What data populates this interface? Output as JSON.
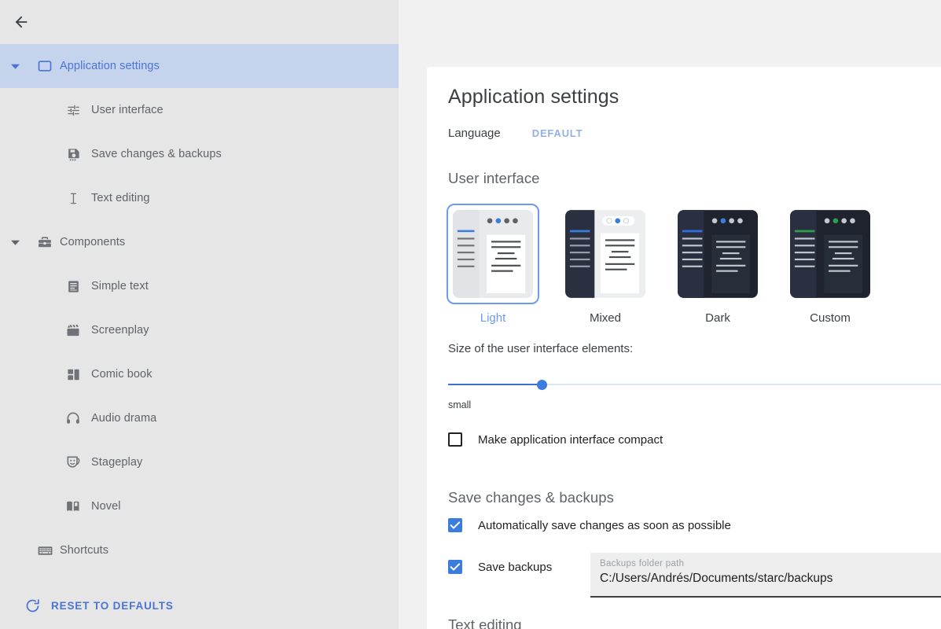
{
  "sidebar": {
    "back_icon": "back-arrow-icon",
    "items": [
      {
        "label": "Application settings",
        "icon": "window-icon",
        "level": 0,
        "selected": true,
        "caret": "down"
      },
      {
        "label": "User interface",
        "icon": "sliders-icon",
        "level": 1,
        "selected": false,
        "caret": ""
      },
      {
        "label": "Save changes & backups",
        "icon": "floppy-disk-icon",
        "level": 1,
        "selected": false,
        "caret": ""
      },
      {
        "label": "Text editing",
        "icon": "text-cursor-icon",
        "level": 1,
        "selected": false,
        "caret": ""
      },
      {
        "label": "Components",
        "icon": "toolbox-icon",
        "level": 0,
        "selected": false,
        "caret": "down"
      },
      {
        "label": "Simple text",
        "icon": "document-lines-icon",
        "level": 1,
        "selected": false,
        "caret": ""
      },
      {
        "label": "Screenplay",
        "icon": "clapperboard-icon",
        "level": 1,
        "selected": false,
        "caret": ""
      },
      {
        "label": "Comic book",
        "icon": "grid-panels-icon",
        "level": 1,
        "selected": false,
        "caret": ""
      },
      {
        "label": "Audio drama",
        "icon": "headphones-icon",
        "level": 1,
        "selected": false,
        "caret": ""
      },
      {
        "label": "Stageplay",
        "icon": "theater-masks-icon",
        "level": 1,
        "selected": false,
        "caret": ""
      },
      {
        "label": "Novel",
        "icon": "open-book-icon",
        "level": 1,
        "selected": false,
        "caret": ""
      },
      {
        "label": "Shortcuts",
        "icon": "keyboard-icon",
        "level": 0,
        "selected": false,
        "caret": ""
      }
    ],
    "reset": {
      "label": "RESET TO DEFAULTS",
      "icon": "refresh-icon"
    }
  },
  "main": {
    "title": "Application settings",
    "language": {
      "label": "Language",
      "value": "DEFAULT"
    },
    "user_interface": {
      "section_title": "User interface",
      "themes": [
        {
          "name": "Light",
          "selected": true,
          "accent": "#3b7ddd"
        },
        {
          "name": "Mixed",
          "selected": false,
          "accent": "#3b7ddd"
        },
        {
          "name": "Dark",
          "selected": false,
          "accent": "#3b7ddd"
        },
        {
          "name": "Custom",
          "selected": false,
          "accent": "#2e9e4f"
        }
      ],
      "size_label": "Size of the user interface elements:",
      "size_min_label": "small",
      "size_percent": 18,
      "compact": {
        "label": "Make application interface compact",
        "checked": false
      }
    },
    "save_backups": {
      "section_title": "Save changes & backups",
      "autosave": {
        "label": "Automatically save changes as soon as possible",
        "checked": true
      },
      "backups": {
        "label": "Save backups",
        "checked": true
      },
      "path_field": {
        "caption": "Backups folder path",
        "value": "C:/Users/Andrés/Documents/starc/backups"
      }
    },
    "text_editing": {
      "section_title": "Text editing"
    }
  },
  "colors": {
    "accent_blue": "#3b7ddd",
    "selected_row_bg": "#c5d4ec",
    "sidebar_bg": "#e6e6e6",
    "page_bg": "#f1f1f1",
    "card_bg": "#ffffff"
  }
}
